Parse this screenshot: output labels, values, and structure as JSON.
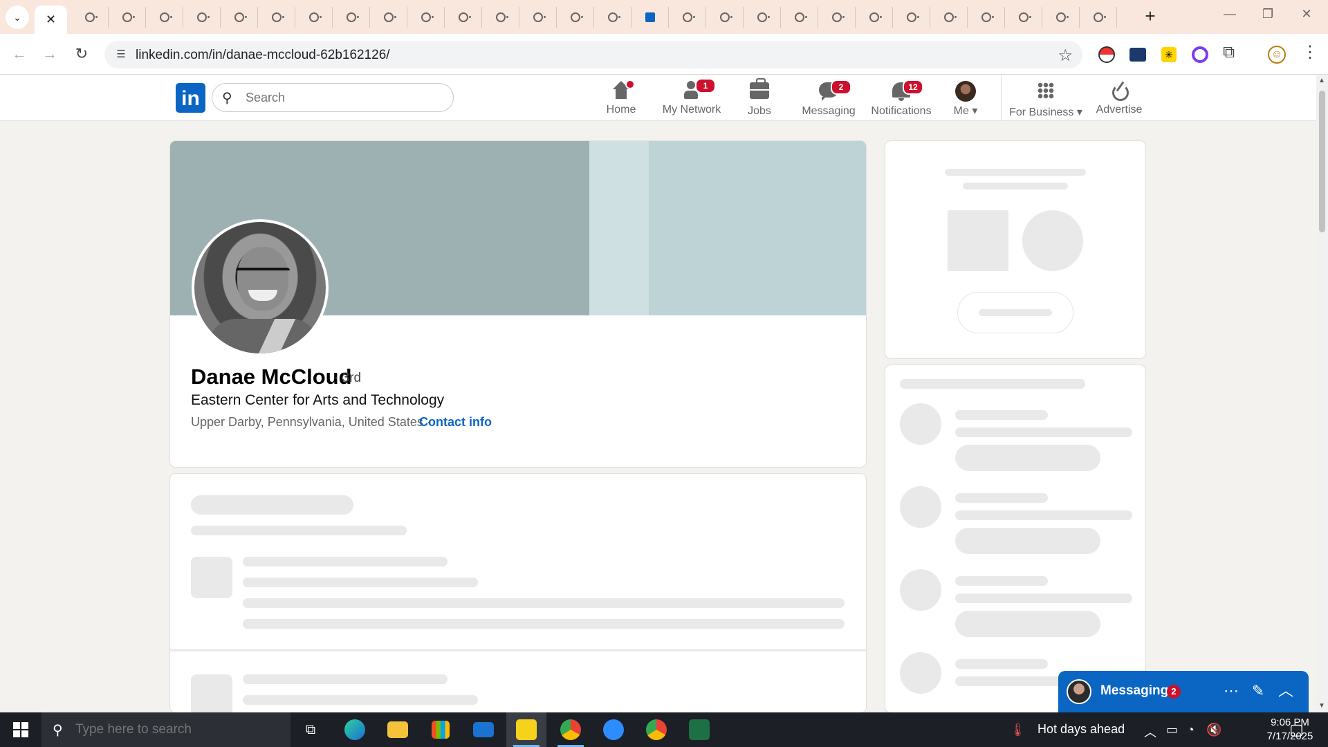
{
  "browser": {
    "url": "linkedin.com/in/danae-mccloud-62b162126/",
    "tab_count_icons": 29,
    "active_tab_close": "✕",
    "new_tab": "+",
    "window_controls": [
      "—",
      "❐",
      "✕"
    ]
  },
  "linkedin": {
    "search_placeholder": "Search",
    "nav": [
      {
        "label": "Home",
        "badge": "",
        "dot": true
      },
      {
        "label": "My Network",
        "badge": "1"
      },
      {
        "label": "Jobs",
        "badge": ""
      },
      {
        "label": "Messaging",
        "badge": "2"
      },
      {
        "label": "Notifications",
        "badge": "12"
      },
      {
        "label": "Me",
        "badge": ""
      },
      {
        "label": "For Business",
        "badge": ""
      },
      {
        "label": "Advertise",
        "badge": ""
      }
    ]
  },
  "profile": {
    "name": "Danae McCloud",
    "degree": "· 3rd",
    "headline": "Eastern Center for Arts and Technology",
    "location": "Upper Darby, Pennsylvania, United States ·",
    "contact_link": "Contact info"
  },
  "messaging": {
    "title": "Messaging",
    "badge": "2"
  },
  "taskbar": {
    "search_placeholder": "Type here to search",
    "weather": "Hot days ahead",
    "time": "9:06 PM",
    "date": "7/17/2025"
  },
  "colors": {
    "linkedin_blue": "#0a66c2",
    "badge_red": "#cb112d",
    "tabstrip": "#f9e6dc"
  }
}
